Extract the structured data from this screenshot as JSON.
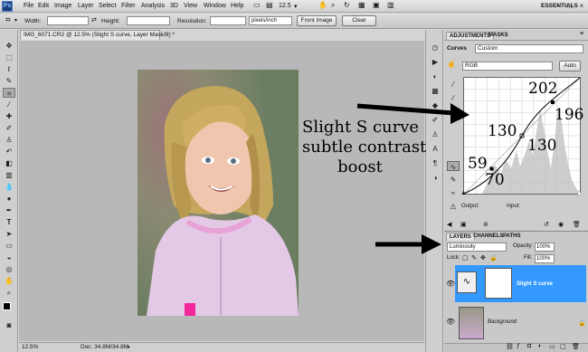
{
  "menubar": {
    "logo": "Ps",
    "items": [
      "File",
      "Edit",
      "Image",
      "Layer",
      "Select",
      "Filter",
      "Analysis",
      "3D",
      "View",
      "Window",
      "Help"
    ],
    "zoom": "12.5",
    "workspace": "ESSENTIALS"
  },
  "options": {
    "width_label": "Width:",
    "height_label": "Height:",
    "resolution_label": "Resolution:",
    "unit": "pixels/inch",
    "front_image": "Front Image",
    "clear": "Clear"
  },
  "document": {
    "tab": "IMG_6071.CR2 @ 12.5% (Slight S curve, Layer Mask/8) *",
    "zoom": "12.5%",
    "doc": "Doc: 34.8M/34.8M"
  },
  "adjustments": {
    "tabs": [
      "ADJUSTMENTS",
      "MASKS"
    ],
    "title": "Curves",
    "preset": "Custom",
    "channel": "RGB",
    "auto": "Auto",
    "output": "Output:",
    "input": "Input:"
  },
  "annotation": {
    "line1": "Slight S curve",
    "line2": "subtle contrast",
    "line3": "boost"
  },
  "curve_labels": [
    "202",
    "196",
    "130",
    "130",
    "59",
    "70"
  ],
  "layers": {
    "tabs": [
      "LAYERS",
      "CHANNELS",
      "PATHS"
    ],
    "blend": "Luminosity",
    "opacity_label": "Opacity:",
    "opacity": "100%",
    "lock_label": "Lock:",
    "fill_label": "Fill:",
    "fill": "100%",
    "items": [
      {
        "name": "Slight S curve"
      },
      {
        "name": "Background"
      }
    ]
  },
  "colors": {
    "selection": "#3399ff"
  }
}
